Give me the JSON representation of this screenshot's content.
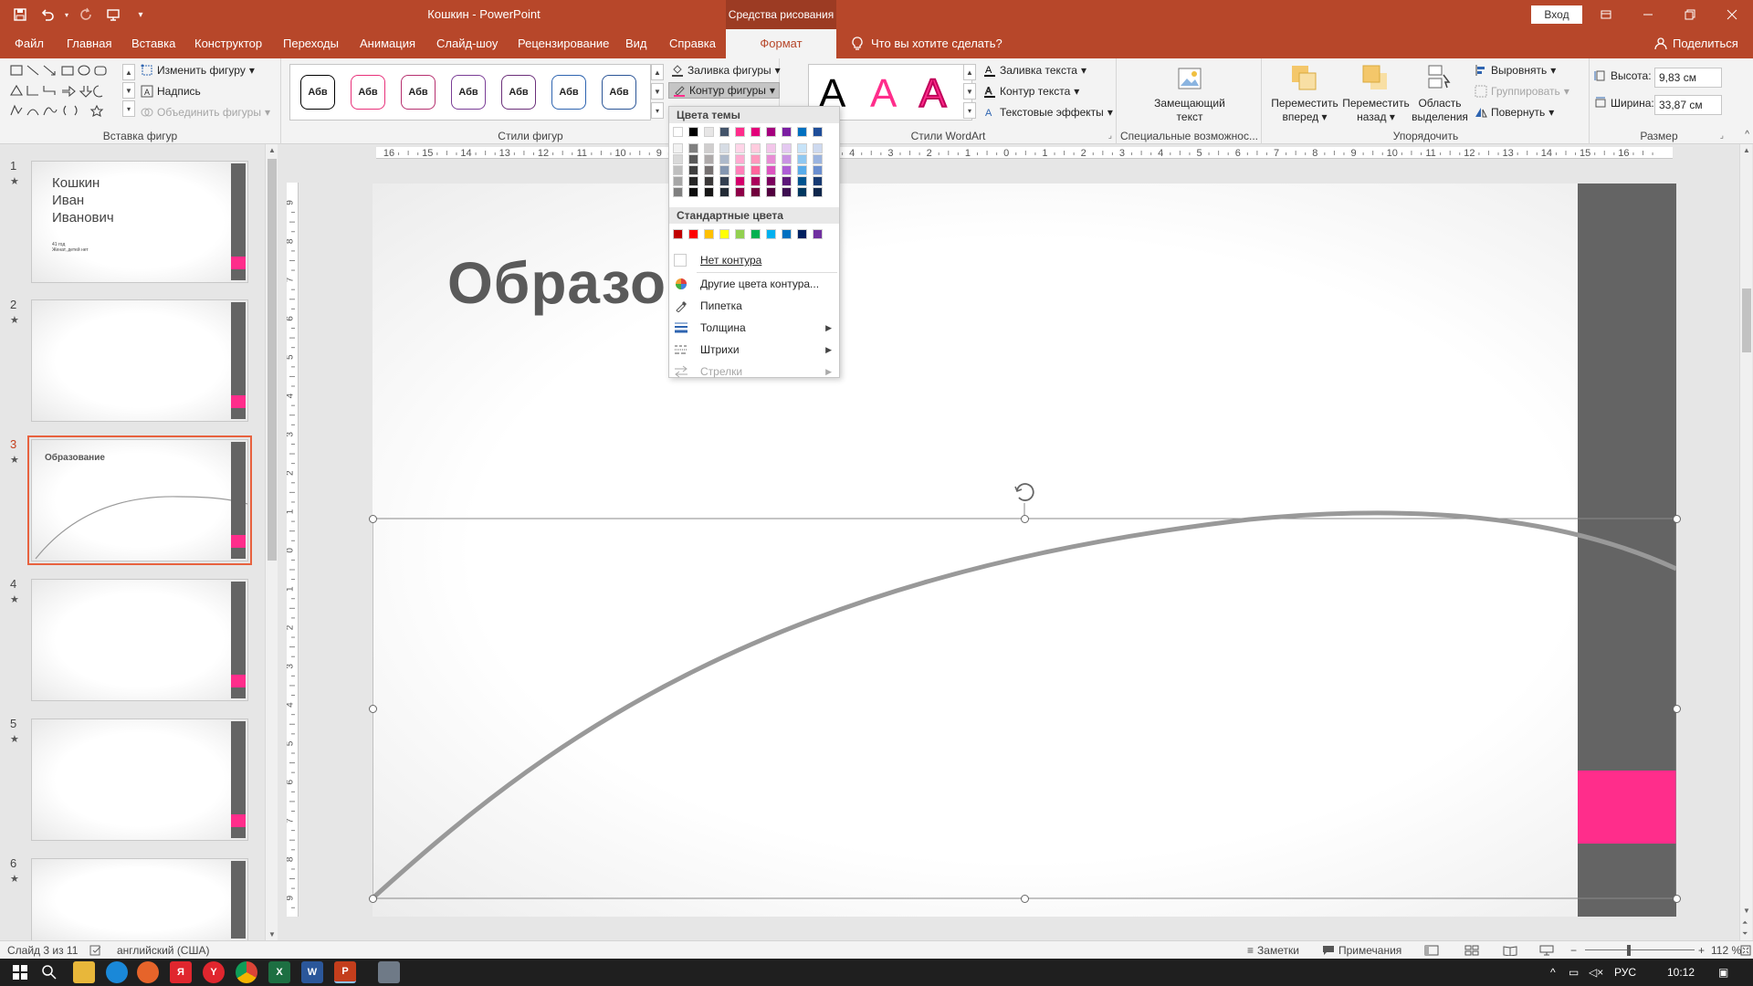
{
  "titlebar": {
    "title": "Кошкин  -  PowerPoint",
    "context_tab": "Средства рисования",
    "login": "Вход",
    "accent": "#b7472a"
  },
  "tabs": {
    "file": "Файл",
    "home": "Главная",
    "insert": "Вставка",
    "design": "Конструктор",
    "transitions": "Переходы",
    "animation": "Анимация",
    "slideshow": "Слайд-шоу",
    "review": "Рецензирование",
    "view": "Вид",
    "help": "Справка",
    "format": "Формат",
    "tell_me": "Что вы хотите сделать?",
    "share": "Поделиться"
  },
  "ribbon": {
    "insert_shapes": {
      "label": "Вставка фигур",
      "edit_shape": "Изменить фигуру",
      "text_box": "Надпись",
      "merge_shapes": "Объединить фигуры"
    },
    "shape_styles": {
      "label": "Стили фигур",
      "sample": "Абв",
      "fill": "Заливка фигуры",
      "outline": "Контур фигуры",
      "style_colors": [
        "#000000",
        "#e8317a",
        "#b6306f",
        "#7a3d96",
        "#6b2f7a",
        "#2e64b0",
        "#2b5597"
      ]
    },
    "wordart": {
      "label": "Стили WordArt",
      "glyph": "A",
      "text_fill": "Заливка текста",
      "text_outline": "Контур текста",
      "text_effects": "Текстовые эффекты"
    },
    "accessibility": {
      "label": "Специальные возможнос...",
      "alt_text_line1": "Замещающий",
      "alt_text_line2": "текст"
    },
    "arrange": {
      "label": "Упорядочить",
      "forward_line1": "Переместить",
      "forward_line2": "вперед",
      "backward_line1": "Переместить",
      "backward_line2": "назад",
      "selection_line1": "Область",
      "selection_line2": "выделения",
      "align": "Выровнять",
      "group": "Группировать",
      "rotate": "Повернуть"
    },
    "size": {
      "label": "Размер",
      "height_label": "Высота:",
      "height_value": "9,83 см",
      "width_label": "Ширина:",
      "width_value": "33,87 см"
    }
  },
  "outline_menu": {
    "theme_colors_header": "Цвета темы",
    "standard_colors_header": "Стандартные цвета",
    "theme_top": [
      "#ffffff",
      "#000000",
      "#e7e6e6",
      "#44546a",
      "#ff2d8b",
      "#e3007a",
      "#a5007e",
      "#7b1fa2",
      "#0070c0",
      "#1f4e99"
    ],
    "theme_shades": [
      [
        "#f2f2f2",
        "#7f7f7f",
        "#d0cece",
        "#d6dce4",
        "#ffd5e8",
        "#ffccde",
        "#f3c6ea",
        "#e4c9f1",
        "#c7e3f8",
        "#cdd9ef"
      ],
      [
        "#d9d9d9",
        "#595959",
        "#aeaaaa",
        "#adb9ca",
        "#ffabd1",
        "#ff99bd",
        "#e88dd5",
        "#c993e3",
        "#90c8f1",
        "#9bb4df"
      ],
      [
        "#bfbfbf",
        "#3f3f3f",
        "#757070",
        "#8496b0",
        "#ff81ba",
        "#ff669c",
        "#dc54c0",
        "#ad5dd5",
        "#58acea",
        "#6a8ecf"
      ],
      [
        "#a6a6a6",
        "#262626",
        "#3a3838",
        "#333f50",
        "#d4006c",
        "#aa005b",
        "#7c005e",
        "#5c1779",
        "#005490",
        "#173a72"
      ],
      [
        "#7f7f7f",
        "#0d0d0d",
        "#171616",
        "#222a35",
        "#8d0048",
        "#71003d",
        "#52003f",
        "#3d0f51",
        "#003860",
        "#0f274c"
      ]
    ],
    "standard": [
      "#c00000",
      "#ff0000",
      "#ffc000",
      "#ffff00",
      "#92d050",
      "#00b050",
      "#00b0f0",
      "#0070c0",
      "#002060",
      "#7030a0"
    ],
    "no_outline": "Нет контура",
    "more_colors": "Другие цвета контура...",
    "eyedropper": "Пипетка",
    "weight": "Толщина",
    "dashes": "Штрихи",
    "arrows": "Стрелки"
  },
  "thumbnails": [
    {
      "num": "1",
      "title_line1": "Кошкин",
      "title_line2": "Иван",
      "title_line3": "Иванович",
      "sub_line1": "41 год",
      "sub_line2": "Женат, детей нет"
    },
    {
      "num": "2"
    },
    {
      "num": "3",
      "title": "Образование"
    },
    {
      "num": "4"
    },
    {
      "num": "5"
    },
    {
      "num": "6"
    }
  ],
  "slide": {
    "title": "Образова",
    "bar_color": "#646464",
    "pink_color": "#ff2d8b",
    "curve_color": "#999999"
  },
  "ruler": {
    "h_ticks": [
      "16",
      "15",
      "14",
      "13",
      "12",
      "11",
      "10",
      "9",
      "8",
      "7",
      "6",
      "5",
      "4",
      "3",
      "2",
      "1",
      "0",
      "1",
      "2",
      "3",
      "4",
      "5",
      "6",
      "7",
      "8",
      "9",
      "10",
      "11",
      "12",
      "13",
      "14",
      "15",
      "16"
    ],
    "v_ticks": [
      "9",
      "8",
      "7",
      "6",
      "5",
      "4",
      "3",
      "2",
      "1",
      "0",
      "1",
      "2",
      "3",
      "4",
      "5",
      "6",
      "7",
      "8",
      "9"
    ]
  },
  "status": {
    "slide": "Слайд 3 из 11",
    "lang": "английский (США)",
    "notes": "Заметки",
    "comments": "Примечания",
    "zoom": "112 %"
  },
  "taskbar": {
    "lang": "РУС",
    "time": "10:12"
  }
}
